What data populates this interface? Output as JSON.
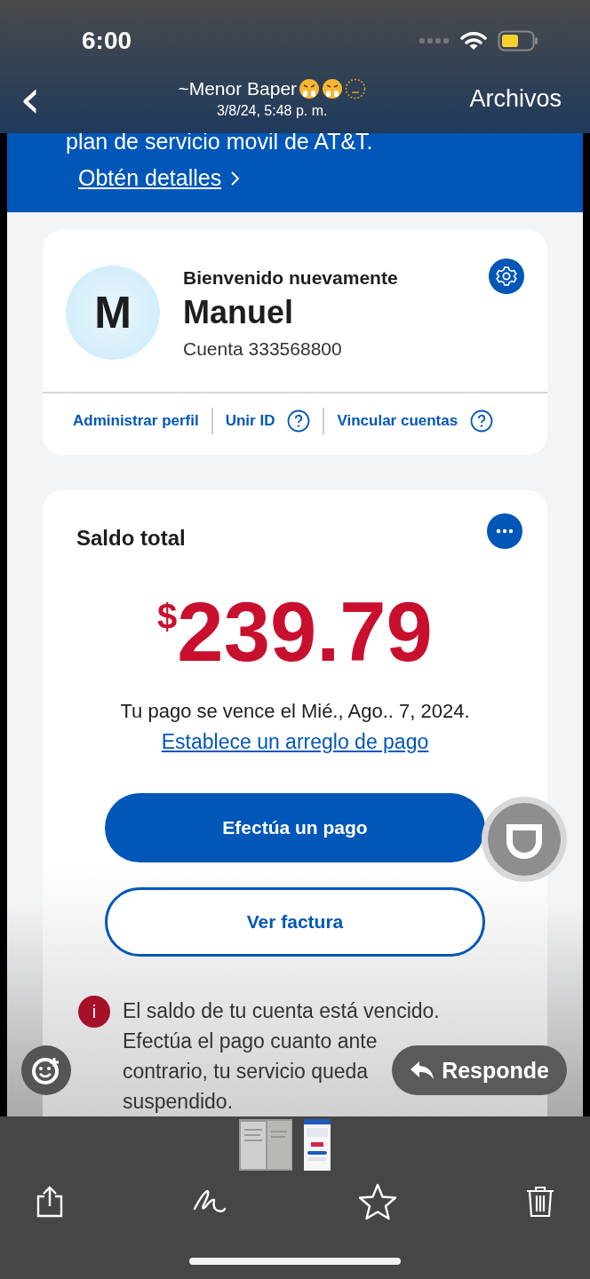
{
  "status_bar": {
    "time": "6:00"
  },
  "header": {
    "back_label": "‹",
    "title": "~Menor Baper",
    "subtitle": "3/8/24, 5:48 p. m.",
    "action": "Archivos"
  },
  "banner": {
    "text": "plan de servicio movil de AT&T.",
    "link": "Obtén detalles"
  },
  "profile": {
    "initial": "M",
    "greeting": "Bienvenido nuevamente",
    "name": "Manuel",
    "account": "Cuenta 333568800",
    "links": [
      {
        "label": "Administrar perfil",
        "help": false
      },
      {
        "label": "Unir ID",
        "help": true
      },
      {
        "label": "Vincular cuentas",
        "help": true
      }
    ]
  },
  "balance": {
    "title": "Saldo total",
    "currency": "$",
    "amount": "239.79",
    "due": "Tu pago se vence el Mié., Ago.. 7, 2024.",
    "link": "Establece un arreglo de pago",
    "buttons": [
      {
        "label": "Efectúa un pago",
        "kind": "primary"
      },
      {
        "label": "Ver factura",
        "kind": "secondary"
      }
    ]
  },
  "alert": {
    "icon": "i",
    "lines": [
      "El saldo de tu cuenta está vencido.",
      "Efectúa el pago cuanto ante",
      "contrario, tu servicio queda",
      "suspendido."
    ]
  },
  "reply_button": "Responde"
}
